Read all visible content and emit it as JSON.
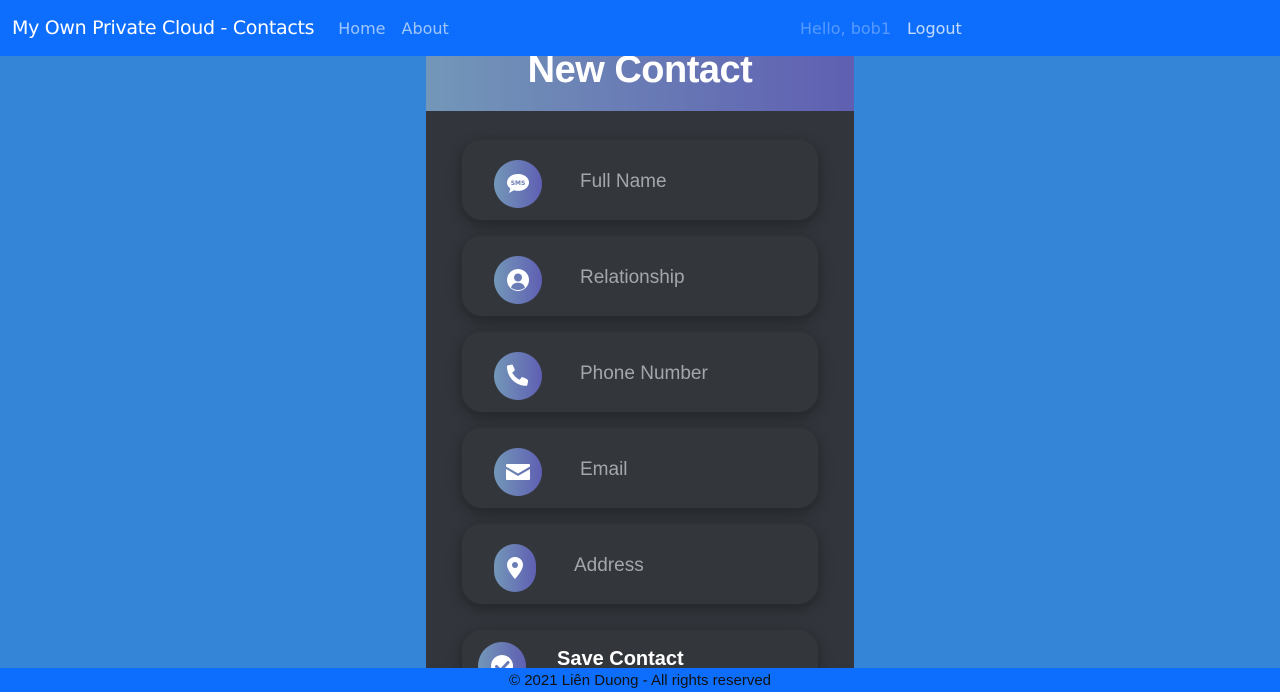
{
  "navbar": {
    "brand": "My Own Private Cloud - Contacts",
    "links": [
      "Home",
      "About"
    ],
    "greeting": "Hello, bob1",
    "logout": "Logout"
  },
  "card": {
    "title": "New Contact",
    "fields": [
      {
        "placeholder": "Full Name",
        "icon": "sms-icon",
        "value": ""
      },
      {
        "placeholder": "Relationship",
        "icon": "user-circle-icon",
        "value": ""
      },
      {
        "placeholder": "Phone Number",
        "icon": "phone-icon",
        "value": ""
      },
      {
        "placeholder": "Email",
        "icon": "envelope-icon",
        "value": ""
      },
      {
        "placeholder": "Address",
        "icon": "map-marker-icon",
        "value": ""
      }
    ],
    "save_label": "Save Contact",
    "save_icon": "check-circle-icon"
  },
  "footer": {
    "text": "© 2021 Liên Duong - All rights reserved"
  },
  "colors": {
    "navbar": "#0d6efd",
    "page_bg": "#3485d8",
    "card_bg": "#32353b",
    "gradient_start": "#7397b8",
    "gradient_end": "#5f5fb2"
  }
}
